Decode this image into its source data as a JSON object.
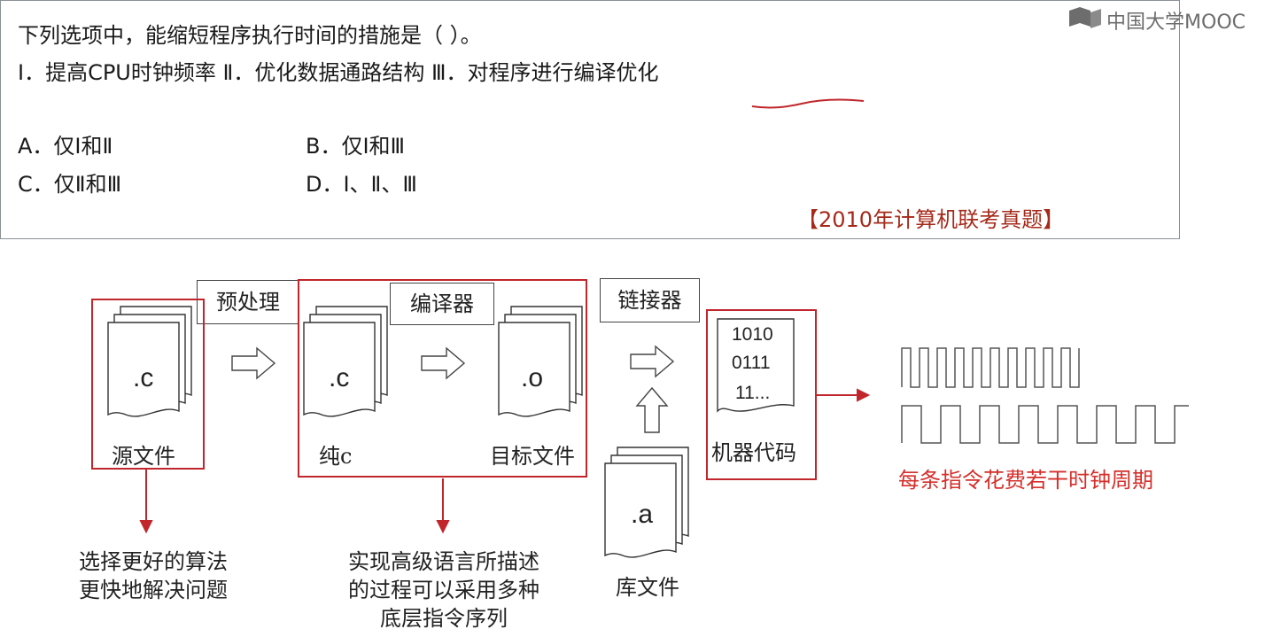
{
  "watermark": {
    "text": "中国大学MOOC",
    "icon": "mooc-logo-icon"
  },
  "question": {
    "stem": "下列选项中，能缩短程序执行时间的措施是（      ）。",
    "statements": "Ⅰ．提高CPU时钟频率  Ⅱ．优化数据通路结构  Ⅲ．对程序进行编译优化",
    "options": {
      "a": "A．仅Ⅰ和Ⅱ",
      "b": "B．仅Ⅰ和Ⅲ",
      "c": "C．仅Ⅱ和Ⅲ",
      "d": "D．Ⅰ、Ⅱ、Ⅲ"
    },
    "source": "【2010年计算机联考真题】"
  },
  "diagram": {
    "preprocess_label": "预处理",
    "compiler_label": "编译器",
    "linker_label": "链接器",
    "source_file_ext": ".c",
    "source_file_caption": "源文件",
    "pure_c_ext": ".c",
    "pure_c_caption": "纯c",
    "object_ext": ".o",
    "object_caption": "目标文件",
    "library_ext": ".a",
    "library_caption": "库文件",
    "machine_code_lines": [
      "1010",
      "0111",
      "11..."
    ],
    "machine_code_caption": "机器代码",
    "clock_note": "每条指令花费若干时钟周期",
    "algorithm_note_1": "选择更好的算法",
    "algorithm_note_2": "更快地解决问题",
    "compiler_note_1": "实现高级语言所描述",
    "compiler_note_2": "的过程可以采用多种",
    "compiler_note_3": "底层指令序列"
  },
  "colors": {
    "accent_red": "#c0262b",
    "note_red": "#d4302c",
    "source_red": "#a52a1a",
    "border_gray": "#8a8f96"
  }
}
